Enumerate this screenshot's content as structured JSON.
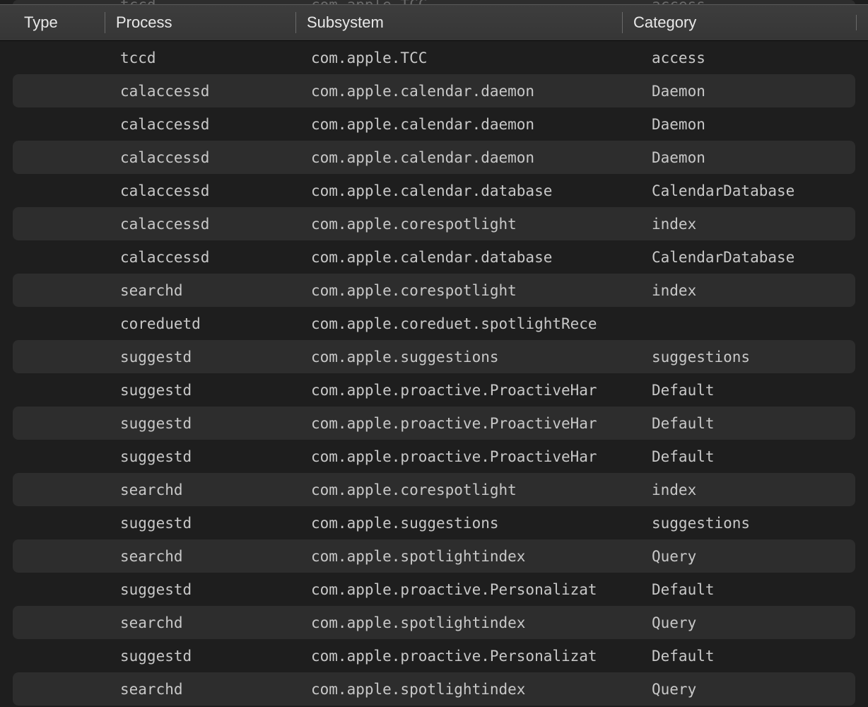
{
  "columns": {
    "type": "Type",
    "process": "Process",
    "subsystem": "Subsystem",
    "category": "Category"
  },
  "peek": {
    "process": "tccd",
    "subsystem": "com.apple.TCC",
    "category": "access"
  },
  "rows": [
    {
      "process": "tccd",
      "subsystem": "com.apple.TCC",
      "category": "access"
    },
    {
      "process": "calaccessd",
      "subsystem": "com.apple.calendar.daemon",
      "category": "Daemon"
    },
    {
      "process": "calaccessd",
      "subsystem": "com.apple.calendar.daemon",
      "category": "Daemon"
    },
    {
      "process": "calaccessd",
      "subsystem": "com.apple.calendar.daemon",
      "category": "Daemon"
    },
    {
      "process": "calaccessd",
      "subsystem": "com.apple.calendar.database",
      "category": "CalendarDatabase"
    },
    {
      "process": "calaccessd",
      "subsystem": "com.apple.corespotlight",
      "category": "index"
    },
    {
      "process": "calaccessd",
      "subsystem": "com.apple.calendar.database",
      "category": "CalendarDatabase"
    },
    {
      "process": "searchd",
      "subsystem": "com.apple.corespotlight",
      "category": "index"
    },
    {
      "process": "coreduetd",
      "subsystem": "com.apple.coreduet.spotlightRece",
      "category": ""
    },
    {
      "process": "suggestd",
      "subsystem": "com.apple.suggestions",
      "category": "suggestions"
    },
    {
      "process": "suggestd",
      "subsystem": "com.apple.proactive.ProactiveHar",
      "category": "Default"
    },
    {
      "process": "suggestd",
      "subsystem": "com.apple.proactive.ProactiveHar",
      "category": "Default"
    },
    {
      "process": "suggestd",
      "subsystem": "com.apple.proactive.ProactiveHar",
      "category": "Default"
    },
    {
      "process": "searchd",
      "subsystem": "com.apple.corespotlight",
      "category": "index"
    },
    {
      "process": "suggestd",
      "subsystem": "com.apple.suggestions",
      "category": "suggestions"
    },
    {
      "process": "searchd",
      "subsystem": "com.apple.spotlightindex",
      "category": "Query"
    },
    {
      "process": "suggestd",
      "subsystem": "com.apple.proactive.Personalizat",
      "category": "Default"
    },
    {
      "process": "searchd",
      "subsystem": "com.apple.spotlightindex",
      "category": "Query"
    },
    {
      "process": "suggestd",
      "subsystem": "com.apple.proactive.Personalizat",
      "category": "Default"
    },
    {
      "process": "searchd",
      "subsystem": "com.apple.spotlightindex",
      "category": "Query"
    }
  ]
}
